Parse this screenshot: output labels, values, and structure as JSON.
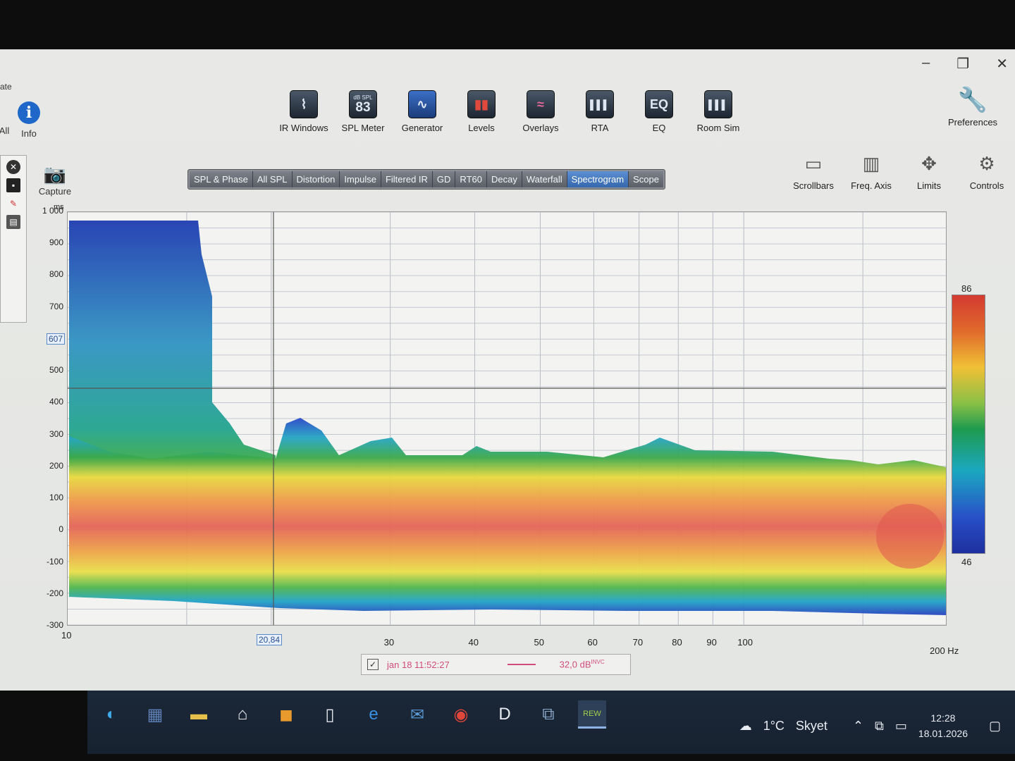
{
  "window": {
    "controls": [
      "–",
      "❐",
      "✕"
    ],
    "left_edge_text": "ate"
  },
  "left_tools": [
    {
      "label": "All"
    },
    {
      "label": "Info"
    }
  ],
  "toolbar": [
    {
      "label": "IR Windows",
      "icon": "ir-windows-icon",
      "glyph": "⌇"
    },
    {
      "label": "SPL Meter",
      "icon": "spl-meter-icon",
      "glyph": "83",
      "sub": "dB SPL"
    },
    {
      "label": "Generator",
      "icon": "generator-icon",
      "glyph": "∿"
    },
    {
      "label": "Levels",
      "icon": "levels-icon",
      "glyph": "▮▮"
    },
    {
      "label": "Overlays",
      "icon": "overlays-icon",
      "glyph": "≈"
    },
    {
      "label": "RTA",
      "icon": "rta-icon",
      "glyph": "▌▌▌"
    },
    {
      "label": "EQ",
      "icon": "eq-icon",
      "glyph": "EQ"
    },
    {
      "label": "Room Sim",
      "icon": "room-sim-icon",
      "glyph": "▌▌▌"
    }
  ],
  "preferences": {
    "label": "Preferences",
    "icon": "wrench-icon"
  },
  "right_tools": [
    {
      "label": "Scrollbars",
      "icon": "scrollbars-icon",
      "glyph": "▭"
    },
    {
      "label": "Freq. Axis",
      "icon": "freq-axis-icon",
      "glyph": "▥"
    },
    {
      "label": "Limits",
      "icon": "limits-icon",
      "glyph": "✥"
    },
    {
      "label": "Controls",
      "icon": "gear-icon",
      "glyph": "⚙"
    }
  ],
  "capture": {
    "label": "Capture",
    "icon": "camera-icon"
  },
  "tabs": [
    "SPL & Phase",
    "All SPL",
    "Distortion",
    "Impulse",
    "Filtered IR",
    "GD",
    "RT60",
    "Decay",
    "Waterfall",
    "Spectrogram",
    "Scope"
  ],
  "active_tab": "Spectrogram",
  "chart_data": {
    "type": "heatmap",
    "ylabel": "ms",
    "y_ticks": [
      "1 000",
      "900",
      "800",
      "700",
      "607",
      "500",
      "400",
      "300",
      "200",
      "100",
      "0",
      "-100",
      "-200",
      "-300"
    ],
    "ylim": [
      -300,
      1000
    ],
    "x_ticks": [
      "10",
      "20,84",
      "30",
      "40",
      "50",
      "60",
      "70",
      "80",
      "90",
      "100",
      "200 Hz"
    ],
    "x_scale": "log",
    "xlim": [
      10,
      200
    ],
    "cursor": {
      "x": "20,84",
      "y": "607"
    },
    "colorbar": {
      "max": "86",
      "min": "46"
    },
    "legend": {
      "checked": true,
      "name": "jan 18 11:52:27",
      "value": "32,0 dB",
      "suffix": "INVC"
    }
  },
  "taskbar": {
    "apps": [
      "edge-icon",
      "store-icon",
      "folder-icon",
      "home-icon",
      "app-icon",
      "file-icon",
      "ie-icon",
      "mail-icon",
      "chrome-icon",
      "d-icon",
      "network-icon",
      "rew-icon"
    ],
    "weather": {
      "temp": "1°C",
      "condition": "Skyet",
      "badge": "1"
    },
    "time": "12:28",
    "date": "18.01.2026"
  }
}
